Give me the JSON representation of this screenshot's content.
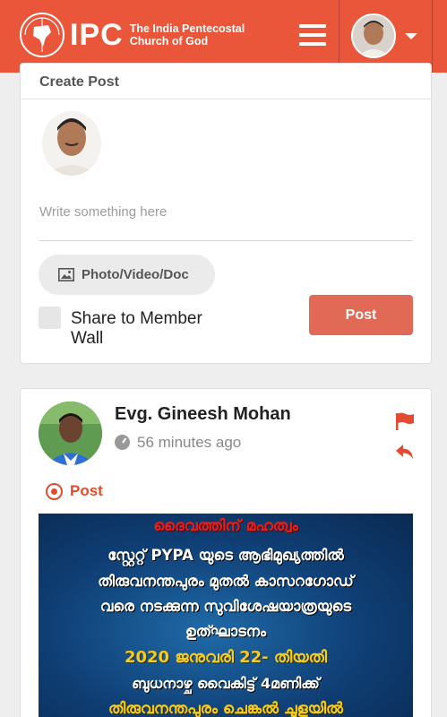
{
  "header": {
    "logo_abbr": "IPC",
    "logo_name_line1": "The India Pentecostal",
    "logo_name_line2": "Church of God",
    "menu_icon": "hamburger-menu-icon",
    "profile_icon": "chevron-down-icon"
  },
  "composer": {
    "title": "Create Post",
    "placeholder": "Write something here",
    "attach_label": "Photo/Video/Doc",
    "share_label": "Share to Member Wall",
    "post_label": "Post"
  },
  "feed": [
    {
      "author": "Evg. Gineesh Mohan",
      "time": "56 minutes ago",
      "type_label": "Post",
      "image_text": [
        "ദൈവത്തിന് മഹത്വം",
        "സ്റ്റേറ്റ് PYPA യുടെ ആഭിമുഖ്യത്തിൽ",
        "തിരുവനന്തപുരം മുതൽ കാസറഗോഡ്",
        "വരെ നടക്കുന്ന സുവിശേഷയാത്രയുടെ",
        "ഉത്ഘാടനം",
        "2020 ജനുവരി 22- തിയതി",
        "ബുധനാഴ്ച വൈകിട്ട് 4മണിക്ക്",
        "തിരുവനന്തപുരം ചെങ്കൽ ചൂളയിൽ"
      ]
    }
  ],
  "colors": {
    "brand": "#e9563a",
    "post_button": "#e06a55",
    "accent_red": "#e24b2f"
  }
}
